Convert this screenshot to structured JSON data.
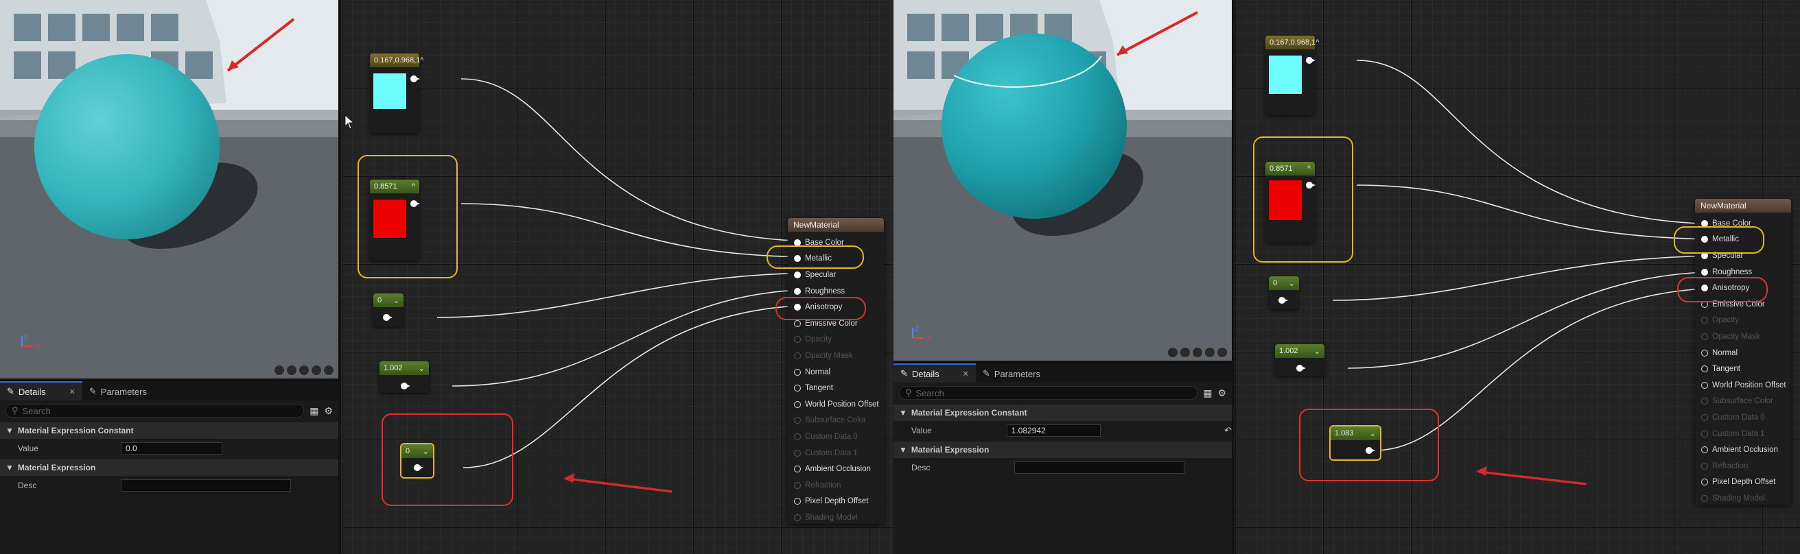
{
  "left": {
    "details": {
      "tab_details": "Details",
      "tab_parameters": "Parameters",
      "search_placeholder": "Search",
      "section_constant": "Material Expression Constant",
      "value_label": "Value",
      "value": "0.0",
      "section_expression": "Material Expression",
      "desc_label": "Desc"
    },
    "nodes": {
      "vector_value": "0.167,0.968,1",
      "red_value": "0.8571",
      "const_a": "0",
      "const_b": "1.002",
      "const_c": "0"
    },
    "material": {
      "title": "NewMaterial",
      "pins": [
        {
          "label": "Base Color",
          "enabled": true
        },
        {
          "label": "Metallic",
          "enabled": true
        },
        {
          "label": "Specular",
          "enabled": true
        },
        {
          "label": "Roughness",
          "enabled": true
        },
        {
          "label": "Anisotropy",
          "enabled": true
        },
        {
          "label": "Emissive Color",
          "enabled": true
        },
        {
          "label": "Opacity",
          "enabled": false
        },
        {
          "label": "Opacity Mask",
          "enabled": false
        },
        {
          "label": "Normal",
          "enabled": true
        },
        {
          "label": "Tangent",
          "enabled": true
        },
        {
          "label": "World Position Offset",
          "enabled": true
        },
        {
          "label": "Subsurface Color",
          "enabled": false
        },
        {
          "label": "Custom Data 0",
          "enabled": false
        },
        {
          "label": "Custom Data 1",
          "enabled": false
        },
        {
          "label": "Ambient Occlusion",
          "enabled": true
        },
        {
          "label": "Refraction",
          "enabled": false
        },
        {
          "label": "Pixel Depth Offset",
          "enabled": true
        },
        {
          "label": "Shading Model",
          "enabled": false
        }
      ]
    }
  },
  "right": {
    "details": {
      "tab_details": "Details",
      "tab_parameters": "Parameters",
      "search_placeholder": "Search",
      "section_constant": "Material Expression Constant",
      "value_label": "Value",
      "value": "1.082942",
      "section_expression": "Material Expression",
      "desc_label": "Desc"
    },
    "nodes": {
      "vector_value": "0.167,0.968,1",
      "red_value": "0.8571",
      "const_a": "0",
      "const_b": "1.002",
      "const_c": "1.083"
    },
    "material": {
      "title": "NewMaterial",
      "pins": [
        {
          "label": "Base Color",
          "enabled": true
        },
        {
          "label": "Metallic",
          "enabled": true
        },
        {
          "label": "Specular",
          "enabled": true
        },
        {
          "label": "Roughness",
          "enabled": true
        },
        {
          "label": "Anisotropy",
          "enabled": true
        },
        {
          "label": "Emissive Color",
          "enabled": true
        },
        {
          "label": "Opacity",
          "enabled": false
        },
        {
          "label": "Opacity Mask",
          "enabled": false
        },
        {
          "label": "Normal",
          "enabled": true
        },
        {
          "label": "Tangent",
          "enabled": true
        },
        {
          "label": "World Position Offset",
          "enabled": true
        },
        {
          "label": "Subsurface Color",
          "enabled": false
        },
        {
          "label": "Custom Data 0",
          "enabled": false
        },
        {
          "label": "Custom Data 1",
          "enabled": false
        },
        {
          "label": "Ambient Occlusion",
          "enabled": true
        },
        {
          "label": "Refraction",
          "enabled": false
        },
        {
          "label": "Pixel Depth Offset",
          "enabled": true
        },
        {
          "label": "Shading Model",
          "enabled": false
        }
      ]
    }
  },
  "colors": {
    "sphere": "#33b7c0",
    "base_color_swatch": "#6ffcff",
    "red_swatch": "#ee0000",
    "highlight_yellow": "#e6b623",
    "highlight_red": "#e03030",
    "arrow_red": "#d42a2a"
  },
  "icons": {
    "details_tab": "pencil-icon",
    "parameters_tab": "pencil-icon",
    "search": "search-icon",
    "grid_view": "grid-icon",
    "settings": "gear-icon",
    "reset": "reset-arrow-icon",
    "collapse": "chevron-up-icon",
    "dropdown": "chevron-down-icon"
  }
}
